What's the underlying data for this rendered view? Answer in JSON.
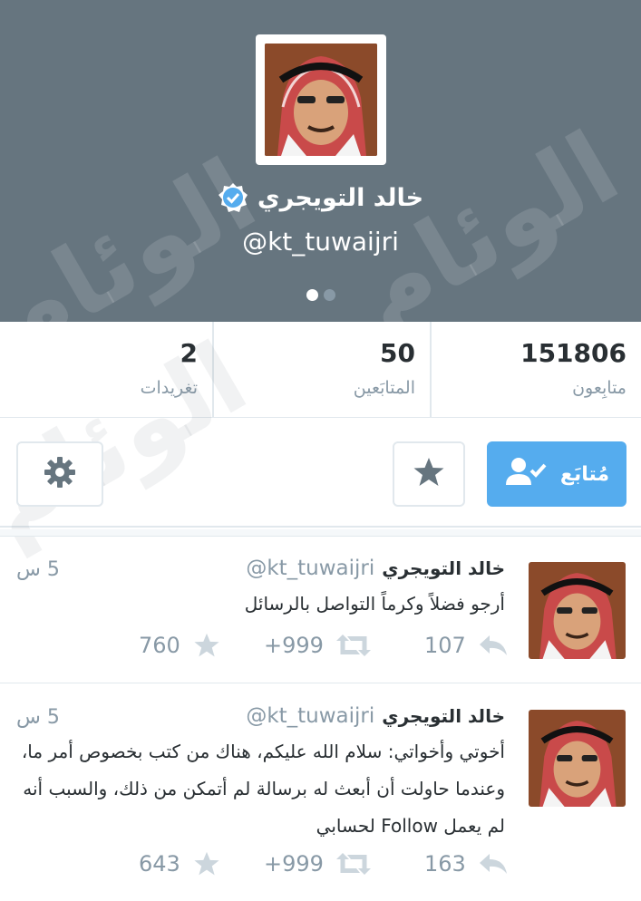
{
  "profile": {
    "display_name": "خالد التويجري",
    "handle": "@kt_tuwaijri",
    "verified": true
  },
  "stats": {
    "followers": {
      "value": "151806",
      "label": "متابِعون"
    },
    "following": {
      "value": "50",
      "label": "المتابَعين"
    },
    "tweets": {
      "value": "2",
      "label": "تغريدات"
    }
  },
  "actions": {
    "follow_label": "مُتابَع"
  },
  "watermark": {
    "text": "الوئام"
  },
  "tweets": [
    {
      "name": "خالد التويجري",
      "handle": "@kt_tuwaijri",
      "time": "5 س",
      "text": "أرجو فضلاً وكرماً التواصل بالرسائل",
      "replies": "107",
      "retweets": "999+",
      "favorites": "760"
    },
    {
      "name": "خالد التويجري",
      "handle": "@kt_tuwaijri",
      "time": "5 س",
      "text": "أخوتي وأخواتي: سلام الله عليكم، هناك من كتب بخصوص أمر ما، وعندما حاولت أن أبعث له برسالة لم أتمكن من ذلك، والسبب أنه لم يعمل Follow لحسابي",
      "replies": "163",
      "retweets": "999+",
      "favorites": "643"
    }
  ],
  "colors": {
    "header_bg": "#66757f",
    "accent": "#55acee",
    "muted": "#8899a6",
    "text": "#292f33"
  }
}
